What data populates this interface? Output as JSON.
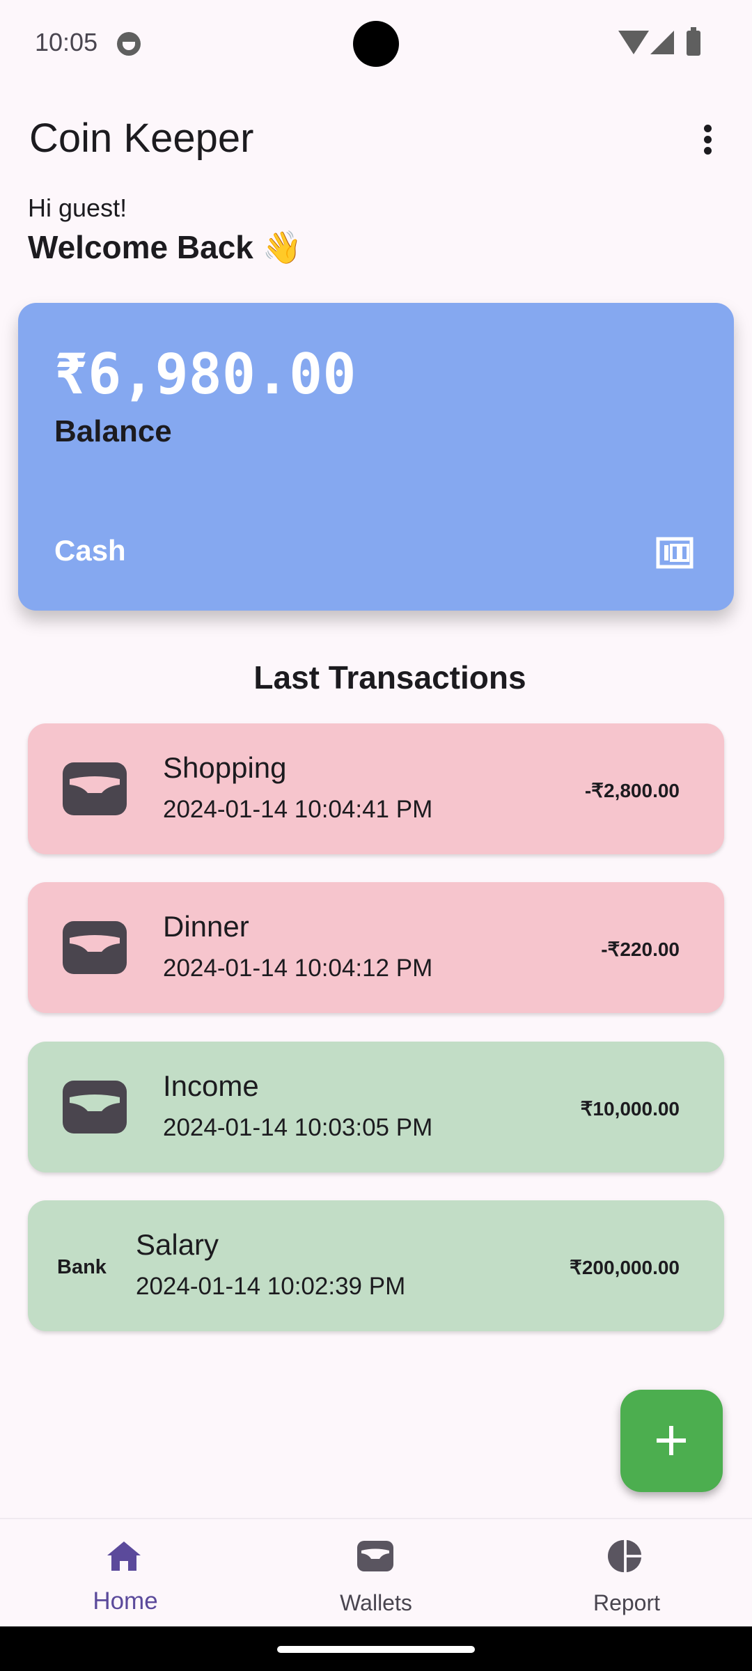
{
  "status_bar": {
    "time": "10:05"
  },
  "app_bar": {
    "title": "Coin Keeper",
    "menu_icon": "more-vert-icon"
  },
  "greeting": {
    "line1": "Hi guest!",
    "line2": "Welcome Back 👋"
  },
  "balance_card": {
    "amount": "₹6,980.00",
    "label": "Balance",
    "wallet": "Cash",
    "wallet_icon": "cash-icon",
    "color": "#85a8f0"
  },
  "transactions": {
    "heading": "Last Transactions",
    "items": [
      {
        "title": "Shopping",
        "date": "2024-01-14 10:04:41 PM",
        "amount": "-₹2,800.00",
        "type": "expense",
        "icon": "wallet-icon"
      },
      {
        "title": "Dinner",
        "date": "2024-01-14 10:04:12 PM",
        "amount": "-₹220.00",
        "type": "expense",
        "icon": "wallet-icon"
      },
      {
        "title": "Income",
        "date": "2024-01-14 10:03:05 PM",
        "amount": "₹10,000.00",
        "type": "income",
        "icon": "wallet-icon"
      },
      {
        "title": "Salary",
        "date": "2024-01-14 10:02:39 PM",
        "amount": "₹200,000.00",
        "type": "income",
        "account": "Bank"
      }
    ]
  },
  "fab": {
    "icon": "plus-icon",
    "color": "#4cae4f"
  },
  "bottom_nav": {
    "items": [
      {
        "label": "Home",
        "icon": "home-icon",
        "selected": true
      },
      {
        "label": "Wallets",
        "icon": "wallet-icon",
        "selected": false
      },
      {
        "label": "Report",
        "icon": "pie-chart-icon",
        "selected": false
      }
    ]
  },
  "colors": {
    "expense": "#f6c5cd",
    "income": "#c2ddc6",
    "accent": "#5b4a9b",
    "background": "#fdf7fb"
  }
}
